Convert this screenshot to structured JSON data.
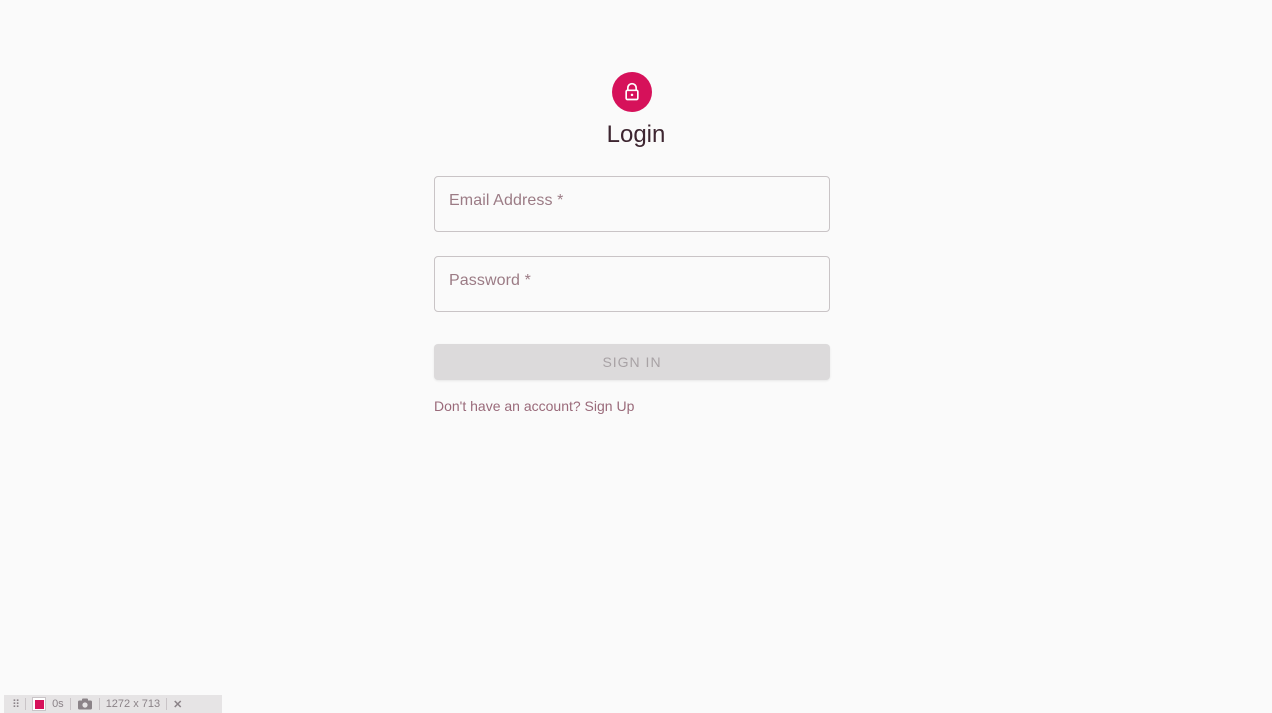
{
  "colors": {
    "accent": "#d6115a",
    "background": "#fafafa"
  },
  "header": {
    "icon": "lock-icon",
    "title": "Login"
  },
  "form": {
    "email": {
      "label": "Email Address *",
      "value": ""
    },
    "password": {
      "label": "Password *",
      "value": ""
    },
    "submit_label": "SIGN IN",
    "signup_link": "Don't have an account? Sign Up"
  },
  "devtools_bar": {
    "grip_icon": "drag-handle-icon",
    "record_icon": "record-icon",
    "timer": "0s",
    "camera_icon": "camera-icon",
    "dimensions": "1272 x 713",
    "close_icon": "close-icon"
  }
}
